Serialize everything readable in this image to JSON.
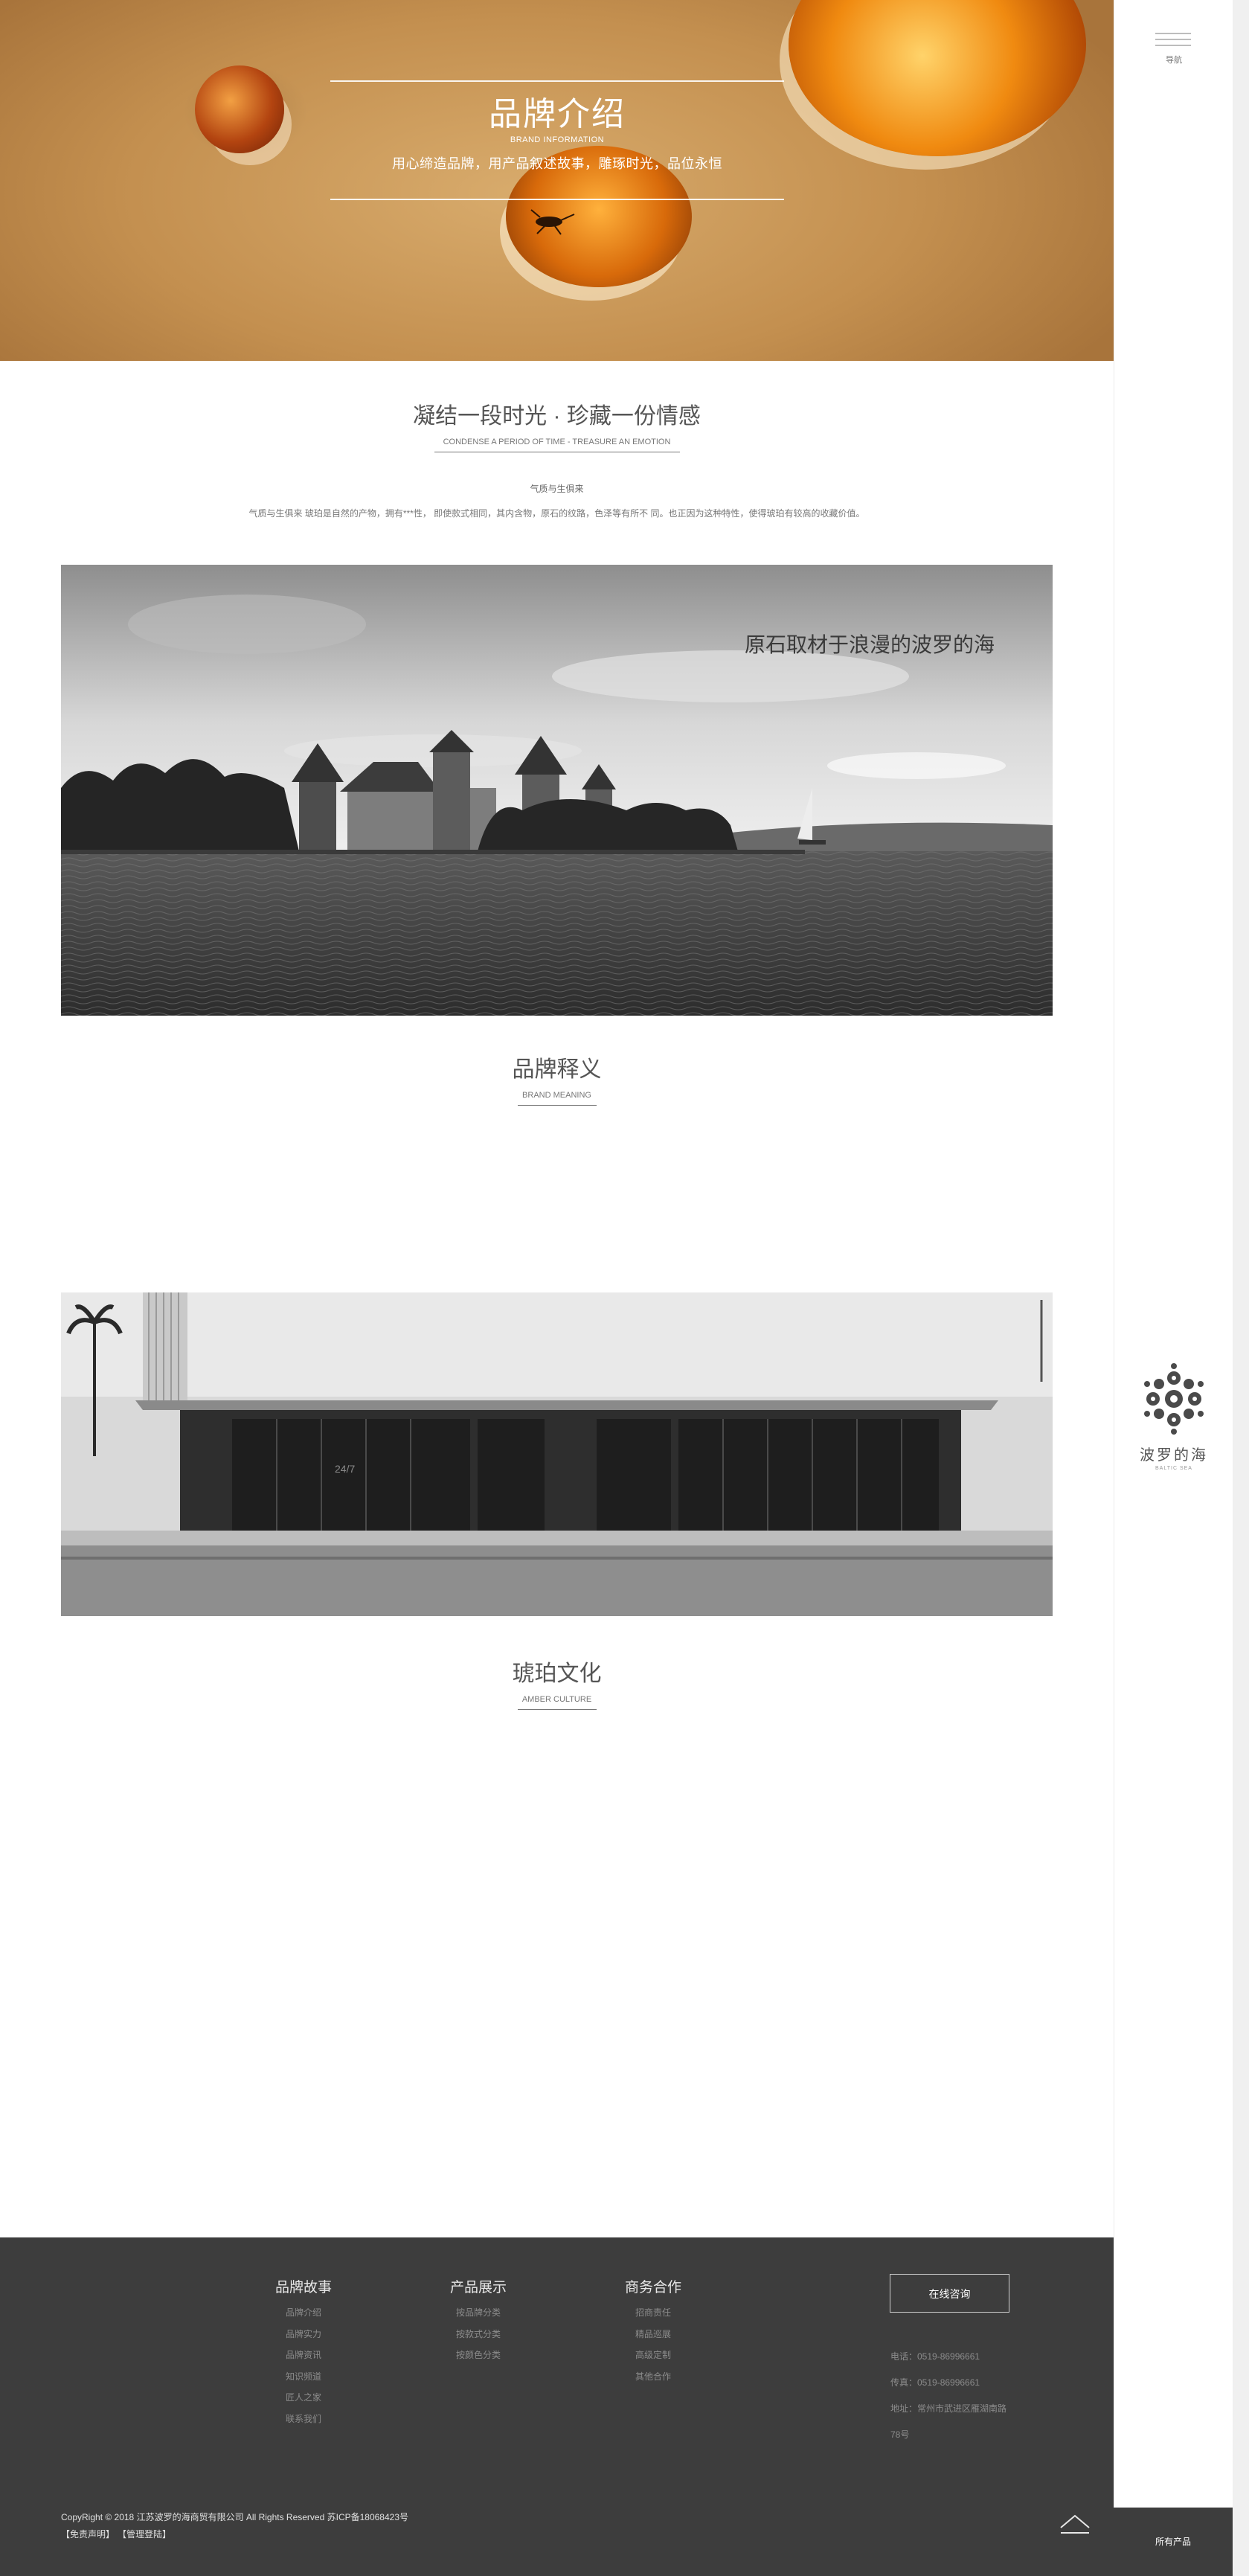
{
  "hero": {
    "title": "品牌介绍",
    "subtitle": "BRAND INFORMATION",
    "slogan": "用心缔造品牌，用产品叙述故事，雕琢时光，品位永恒"
  },
  "intro": {
    "title": "凝结一段时光 · 珍藏一份情感",
    "subtitle": "CONDENSE A PERIOD OF TIME - TREASURE AN EMOTION",
    "label": "气质与生俱来",
    "text": "气质与生俱来 琥珀是自然的产物，拥有***性， 即使款式相同，其内含物，原石的纹路，色泽等有所不 同。也正因为这种特性，使得琥珀有较高的收藏价值。"
  },
  "photo1": {
    "caption": "原石取材于浪漫的波罗的海"
  },
  "brand_meaning": {
    "title": "品牌释义",
    "subtitle": "BRAND MEANING"
  },
  "photo2": {
    "store_sign": "24/7"
  },
  "amber_culture": {
    "title": "琥珀文化",
    "subtitle": "AMBER CULTURE"
  },
  "footer": {
    "columns": [
      {
        "heading": "品牌故事",
        "links": [
          "品牌介绍",
          "品牌实力",
          "品牌资讯",
          "知识频道",
          "匠人之家",
          "联系我们"
        ]
      },
      {
        "heading": "产品展示",
        "links": [
          "按品牌分类",
          "按款式分类",
          "按颜色分类"
        ]
      },
      {
        "heading": "商务合作",
        "links": [
          "招商责任",
          "精品巡展",
          "高级定制",
          "其他合作"
        ]
      }
    ],
    "consult_button": "在线咨询",
    "contact": {
      "phone": "电话：0519-86996661",
      "fax": "传真：0519-86996661",
      "address_line1": "地址：常州市武进区雁湖南路",
      "address_line2": "78号"
    },
    "copyright": "CopyRight © 2018 江苏波罗的海商贸有限公司 All Rights Reserved 苏ICP备18068423号",
    "disclaimer": "【免责声明】",
    "admin_login": "【管理登陆】"
  },
  "sidebar": {
    "nav_label": "导航",
    "logo_cn": "波罗的海",
    "logo_en": "BALTIC SEA",
    "all_products": "所有产品"
  }
}
